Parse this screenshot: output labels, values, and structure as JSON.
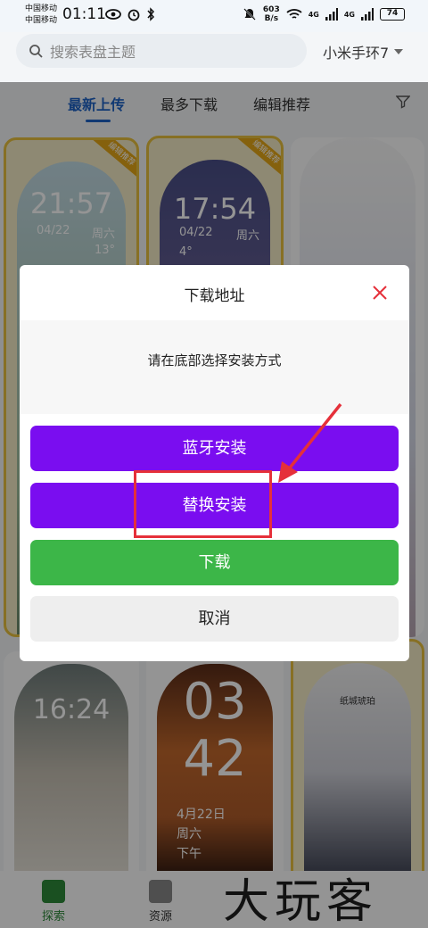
{
  "status_bar": {
    "carrier_1": "中国移动",
    "carrier_2": "中国移动",
    "time": "01:11",
    "net_speed_value": "603",
    "net_speed_unit": "B/s",
    "signal_1": "4G",
    "signal_2": "4G",
    "battery": "74"
  },
  "search": {
    "placeholder": "搜索表盘主题",
    "device_label": "小米手环7"
  },
  "tabs": [
    {
      "label": "最新上传",
      "active": true
    },
    {
      "label": "最多下载",
      "active": false
    },
    {
      "label": "编辑推荐",
      "active": false
    }
  ],
  "cards": {
    "card1": {
      "badge": "编辑推荐",
      "time": "21:57",
      "date": "04/22",
      "weekday": "周六",
      "temp": "13°"
    },
    "card2": {
      "badge": "编辑推荐",
      "time": "17:54",
      "date": "04/22",
      "weekday": "周六",
      "temp": "4°"
    },
    "card4": {
      "time": "16:24"
    },
    "card5": {
      "hour": "03",
      "minute": "42",
      "date": "4月22日",
      "weekday": "周六",
      "period": "下午"
    },
    "card6": {
      "caption": "纸城琥珀"
    }
  },
  "dialog": {
    "title": "下载地址",
    "message": "请在底部选择安装方式",
    "buttons": {
      "bluetooth": "蓝牙安装",
      "replace": "替换安装",
      "download": "下载",
      "cancel": "取消"
    }
  },
  "bottom_nav": [
    {
      "label": "探索",
      "active": true
    },
    {
      "label": "资源",
      "active": false
    }
  ],
  "watermark": "大玩客",
  "colors": {
    "accent_blue": "#1e63c6",
    "purple_button": "#7a0df0",
    "green_button": "#3cb648",
    "annotation_red": "#e5303a",
    "badge_gold": "#e6a817"
  }
}
